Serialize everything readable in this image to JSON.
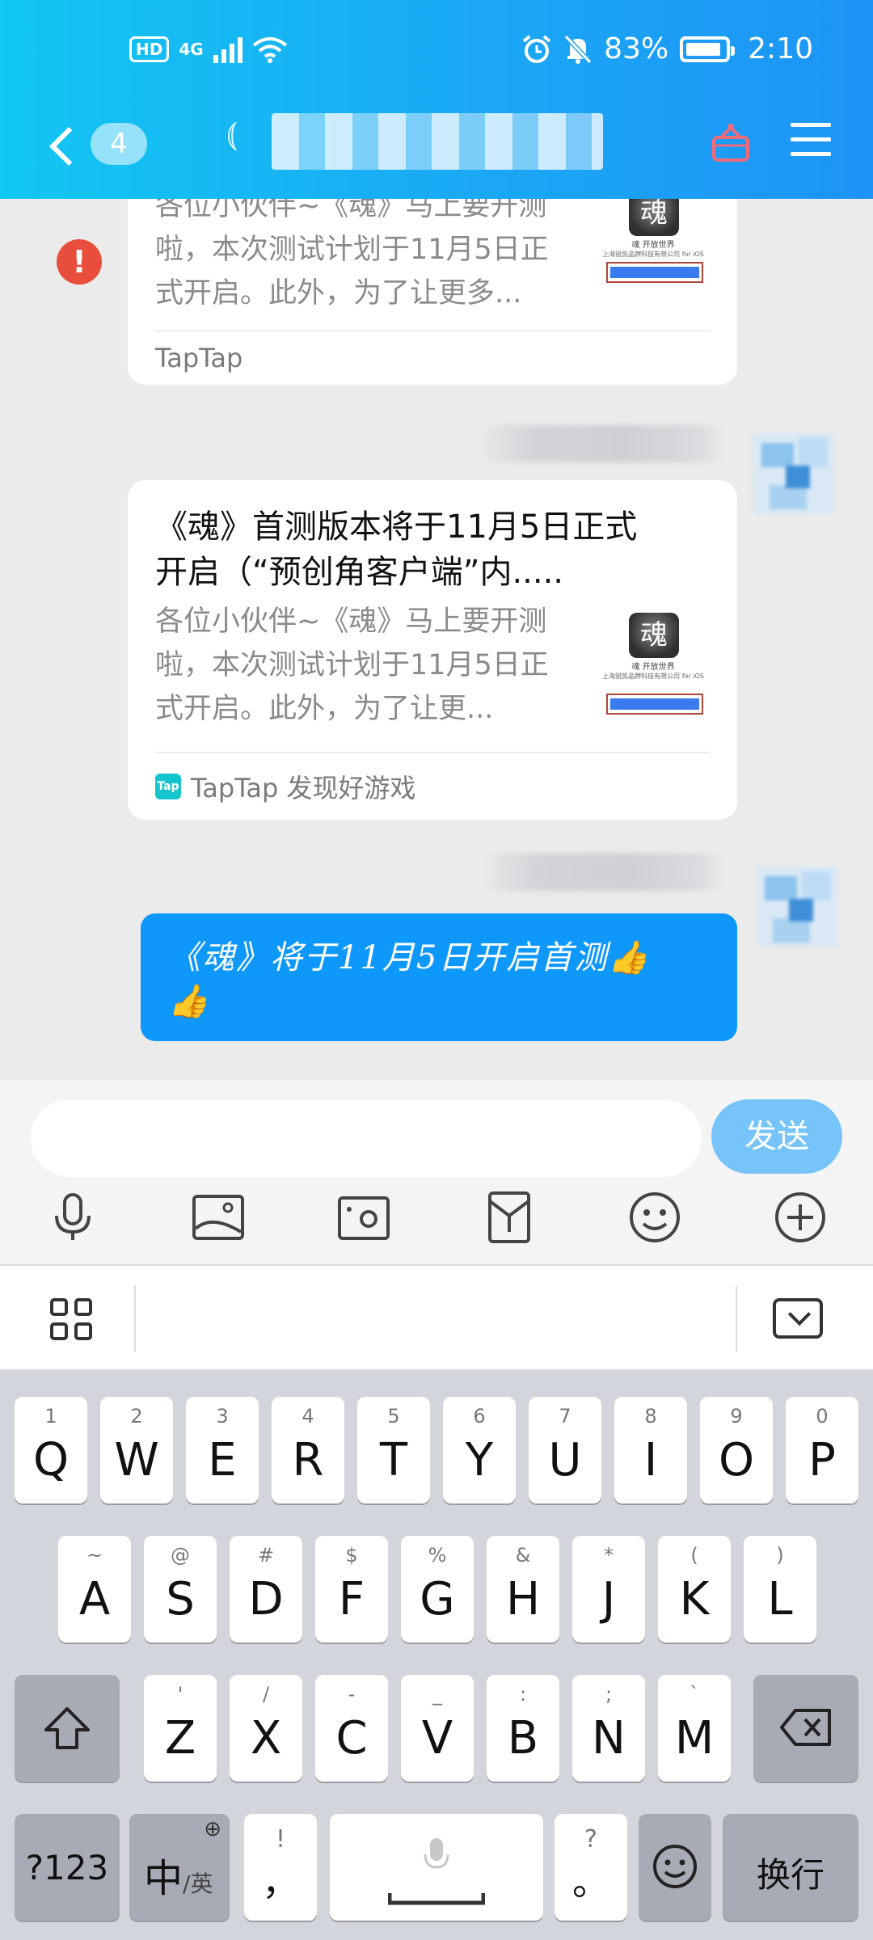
{
  "status_bar": {
    "hd": "HD",
    "network": "4G",
    "battery_percent": "83%",
    "time": "2:10"
  },
  "header": {
    "unread_count": "4",
    "title": "",
    "icons": [
      "back-chevron-icon",
      "ear-icon",
      "gift-icon",
      "menu-icon"
    ],
    "gradient": [
      "#12c7f2",
      "#1d94f6"
    ]
  },
  "chat": {
    "card_partial": {
      "description": "各位小伙伴~《魂》马上要开测啦，本次测试计划于11月5日正式开启。此外，为了让更多...",
      "desc_line1": "各位小伙伴~《魂》马上要开测",
      "desc_line2": "啦，本次测试计划于11月5日正",
      "desc_line3": "式开启。此外，为了让更多...",
      "source": "TapTap",
      "thumb_title": "魂 开放世界",
      "thumb_company": "上海锐凯品牌科技有限公司 for iOS"
    },
    "card_full": {
      "title_line1": "《魂》首测版本将于11月5日正式",
      "title_line2": "开启（“预创角客户端”内.....",
      "desc_line1": "各位小伙伴~《魂》马上要开测",
      "desc_line2": "啦，本次测试计划于11月5日正",
      "desc_line3": "式开启。此外，为了让更...",
      "source": "TapTap 发现好游戏",
      "source_icon_text": "Tap",
      "thumb_title": "魂 开放世界",
      "thumb_company": "上海锐凯品牌科技有限公司 for iOS"
    },
    "my_message": {
      "line1": "《魂》将于11月5日开启首测👍",
      "line2": "👍"
    },
    "colors": {
      "bubble": "#0f98fb",
      "error": "#e84e3c"
    }
  },
  "composer": {
    "input_value": "",
    "send_label": "发送",
    "tools": [
      "microphone-icon",
      "image-icon",
      "camera-icon",
      "red-packet-icon",
      "emoji-icon",
      "plus-icon"
    ]
  },
  "keyboard": {
    "row1": [
      {
        "main": "Q",
        "sub": "1"
      },
      {
        "main": "W",
        "sub": "2"
      },
      {
        "main": "E",
        "sub": "3"
      },
      {
        "main": "R",
        "sub": "4"
      },
      {
        "main": "T",
        "sub": "5"
      },
      {
        "main": "Y",
        "sub": "6"
      },
      {
        "main": "U",
        "sub": "7"
      },
      {
        "main": "I",
        "sub": "8"
      },
      {
        "main": "O",
        "sub": "9"
      },
      {
        "main": "P",
        "sub": "0"
      }
    ],
    "row2": [
      {
        "main": "A",
        "sub": "~"
      },
      {
        "main": "S",
        "sub": "@"
      },
      {
        "main": "D",
        "sub": "#"
      },
      {
        "main": "F",
        "sub": "$"
      },
      {
        "main": "G",
        "sub": "%"
      },
      {
        "main": "H",
        "sub": "&"
      },
      {
        "main": "J",
        "sub": "*"
      },
      {
        "main": "K",
        "sub": "("
      },
      {
        "main": "L",
        "sub": ")"
      }
    ],
    "row3": [
      {
        "main": "Z",
        "sub": "'"
      },
      {
        "main": "X",
        "sub": "/"
      },
      {
        "main": "C",
        "sub": "-"
      },
      {
        "main": "V",
        "sub": "_"
      },
      {
        "main": "B",
        "sub": ":"
      },
      {
        "main": "N",
        "sub": ";"
      },
      {
        "main": "M",
        "sub": "`"
      }
    ],
    "numbers_label": "?123",
    "lang_main": "中",
    "lang_sub": "/英",
    "comma_main": "，",
    "comma_sub": "!",
    "period_main": "。",
    "period_sub": "?",
    "enter_label": "换行"
  }
}
